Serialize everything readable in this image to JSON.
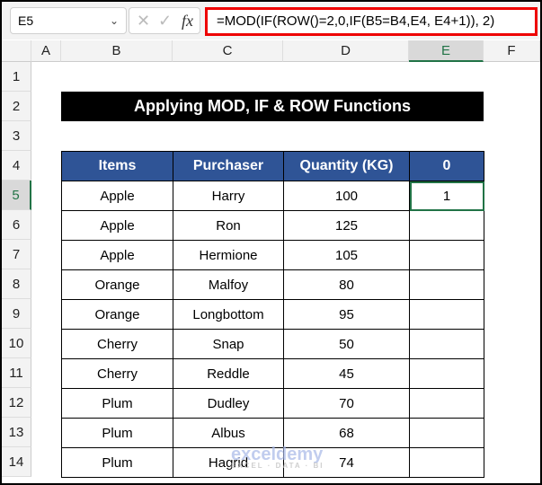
{
  "name_box": "E5",
  "formula": "=MOD(IF(ROW()=2,0,IF(B5=B4,E4, E4+1)), 2)",
  "fx_label": "fx",
  "columns": [
    "A",
    "B",
    "C",
    "D",
    "E",
    "F"
  ],
  "rows": [
    "1",
    "2",
    "3",
    "4",
    "5",
    "6",
    "7",
    "8",
    "9",
    "10",
    "11",
    "12",
    "13",
    "14"
  ],
  "title": "Applying MOD, IF & ROW Functions",
  "headers": [
    "Items",
    "Purchaser",
    "Quantity (KG)",
    "0"
  ],
  "data": [
    [
      "Apple",
      "Harry",
      "100",
      "1"
    ],
    [
      "Apple",
      "Ron",
      "125",
      ""
    ],
    [
      "Apple",
      "Hermione",
      "105",
      ""
    ],
    [
      "Orange",
      "Malfoy",
      "80",
      ""
    ],
    [
      "Orange",
      "Longbottom",
      "95",
      ""
    ],
    [
      "Cherry",
      "Snap",
      "50",
      ""
    ],
    [
      "Cherry",
      "Reddle",
      "45",
      ""
    ],
    [
      "Plum",
      "Dudley",
      "70",
      ""
    ],
    [
      "Plum",
      "Albus",
      "68",
      ""
    ],
    [
      "Plum",
      "Hagrid",
      "74",
      ""
    ]
  ],
  "watermark": "exceldemy",
  "watermark_sub": "EXCEL · DATA · BI"
}
